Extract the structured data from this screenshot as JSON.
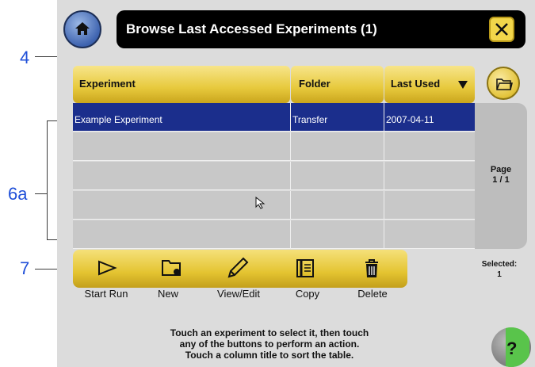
{
  "callouts": {
    "c4": "4",
    "c6a": "6a",
    "c7": "7"
  },
  "header": {
    "title": "Browse Last Accessed Experiments (1)"
  },
  "columns": {
    "experiment": "Experiment",
    "folder": "Folder",
    "last_used": "Last Used"
  },
  "table": {
    "rows": [
      {
        "experiment": "Example Experiment",
        "folder": "Transfer",
        "last_used": "2007-04-11",
        "selected": true
      },
      {
        "experiment": "",
        "folder": "",
        "last_used": ""
      },
      {
        "experiment": "",
        "folder": "",
        "last_used": ""
      },
      {
        "experiment": "",
        "folder": "",
        "last_used": ""
      },
      {
        "experiment": "",
        "folder": "",
        "last_used": ""
      }
    ]
  },
  "pager": {
    "label": "Page",
    "value": "1 / 1"
  },
  "toolbar": {
    "start_run": "Start Run",
    "new": "New",
    "view_edit": "View/Edit",
    "copy": "Copy",
    "delete": "Delete"
  },
  "selection": {
    "label": "Selected:",
    "count": "1"
  },
  "instructions": {
    "line1": "Touch an experiment to select it, then touch",
    "line2": "any of the buttons to perform an action.",
    "line3": "Touch a column title to sort the table."
  },
  "help": {
    "label": "?"
  },
  "colors": {
    "accent_yellow": "#e7c93c",
    "selection_blue": "#1b2e8c",
    "panel_gray": "#dcdcdc"
  },
  "icons": [
    "home-icon",
    "close-icon",
    "folder-open-icon",
    "play-icon",
    "new-folder-icon",
    "pencil-icon",
    "copy-icon",
    "trash-icon",
    "help-icon",
    "cursor-icon"
  ]
}
